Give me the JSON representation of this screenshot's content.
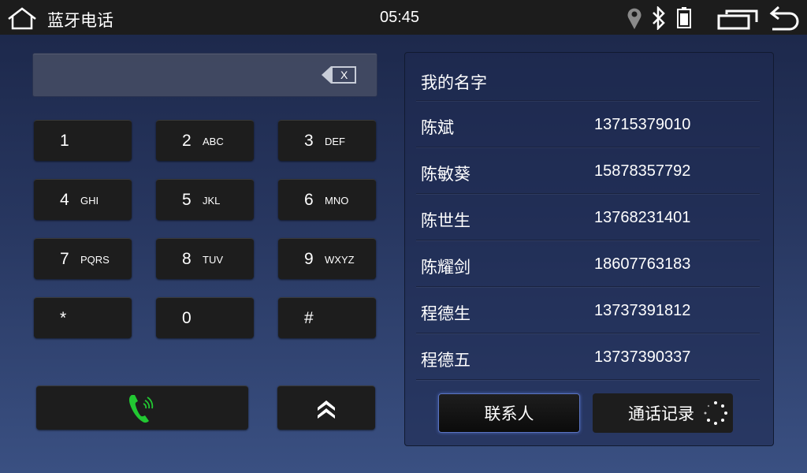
{
  "statusbar": {
    "title": "蓝牙电话",
    "time": "05:45",
    "icons": [
      "home-icon",
      "location-icon",
      "bluetooth-icon",
      "battery-icon",
      "recent-apps-icon",
      "back-icon"
    ]
  },
  "dialer": {
    "input_value": "",
    "backspace_label": "X",
    "keys": [
      {
        "digit": "1",
        "letters": ""
      },
      {
        "digit": "2",
        "letters": "ABC"
      },
      {
        "digit": "3",
        "letters": "DEF"
      },
      {
        "digit": "4",
        "letters": "GHI"
      },
      {
        "digit": "5",
        "letters": "JKL"
      },
      {
        "digit": "6",
        "letters": "MNO"
      },
      {
        "digit": "7",
        "letters": "PQRS"
      },
      {
        "digit": "8",
        "letters": "TUV"
      },
      {
        "digit": "9",
        "letters": "WXYZ"
      },
      {
        "digit": "*",
        "letters": ""
      },
      {
        "digit": "0",
        "letters": ""
      },
      {
        "digit": "#",
        "letters": ""
      }
    ],
    "call_color": "#22c832"
  },
  "contacts": {
    "header": "我的名字",
    "rows": [
      {
        "name": "陈斌",
        "phone": "13715379010"
      },
      {
        "name": "陈敏葵",
        "phone": "15878357792"
      },
      {
        "name": "陈世生",
        "phone": "13768231401"
      },
      {
        "name": "陈耀剑",
        "phone": "18607763183"
      },
      {
        "name": "程德生",
        "phone": "13737391812"
      },
      {
        "name": "程德五",
        "phone": "13737390337"
      }
    ],
    "tab_contacts": "联系人",
    "tab_calllog": "通话记录"
  }
}
